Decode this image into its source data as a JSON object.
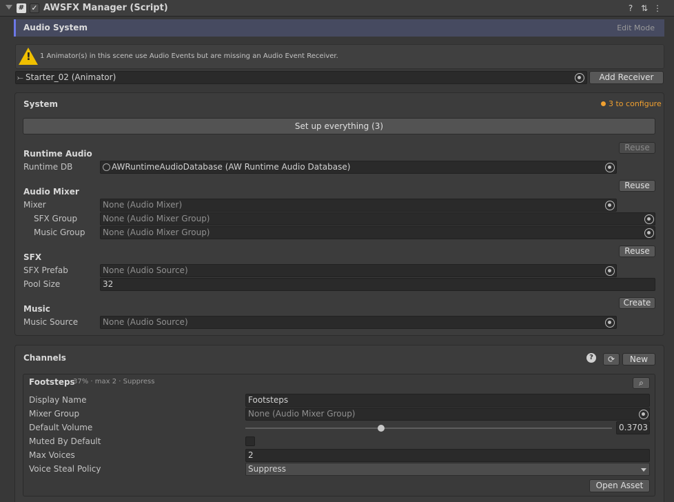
{
  "header": {
    "title": "AWSFX Manager (Script)",
    "script_glyph": "#",
    "toggle_glyph": "✓",
    "help_glyph": "?",
    "settings_glyph": "⇅",
    "menu_glyph": "⋮"
  },
  "banner": {
    "title": "Audio System",
    "mode": "Edit Mode"
  },
  "warning": {
    "text": "1 Animator(s) in this scene use Audio Events but are missing an Audio Event Receiver.",
    "animator_value": "Starter_02 (Animator)",
    "animator_glyph": "⤚",
    "add_receiver_label": "Add Receiver"
  },
  "system": {
    "title": "System",
    "status": "3 to configure",
    "status_color": "#f0a030",
    "setup_label": "Set up everything  (3)",
    "runtime_audio": {
      "title": "Runtime Audio",
      "reuse_label": "Reuse",
      "db_label": "Runtime DB",
      "db_value": "AWRuntimeAudioDatabase (AW Runtime Audio Database)"
    },
    "audio_mixer": {
      "title": "Audio Mixer",
      "reuse_label": "Reuse",
      "mixer_label": "Mixer",
      "mixer_value": "None (Audio Mixer)",
      "sfx_group_label": "SFX Group",
      "sfx_group_value": "None (Audio Mixer Group)",
      "music_group_label": "Music Group",
      "music_group_value": "None (Audio Mixer Group)"
    },
    "sfx": {
      "title": "SFX",
      "reuse_label": "Reuse",
      "prefab_label": "SFX Prefab",
      "prefab_value": "None (Audio Source)",
      "pool_label": "Pool Size",
      "pool_value": "32"
    },
    "music": {
      "title": "Music",
      "create_label": "Create",
      "source_label": "Music Source",
      "source_value": "None (Audio Source)"
    }
  },
  "channels": {
    "title": "Channels",
    "help_glyph": "?",
    "refresh_glyph": "⟳",
    "new_label": "New",
    "item": {
      "name": "Footsteps",
      "summary": "37% · max 2 · Suppress",
      "search_glyph": "⌕",
      "display_name_label": "Display Name",
      "display_name_value": "Footsteps",
      "mixer_group_label": "Mixer Group",
      "mixer_group_value": "None (Audio Mixer Group)",
      "default_volume_label": "Default Volume",
      "default_volume_value": "0.3703",
      "default_volume_fraction": 0.3703,
      "muted_label": "Muted By Default",
      "muted_value": false,
      "max_voices_label": "Max Voices",
      "max_voices_value": "2",
      "steal_policy_label": "Voice Steal Policy",
      "steal_policy_value": "Suppress",
      "open_asset_label": "Open Asset"
    }
  }
}
